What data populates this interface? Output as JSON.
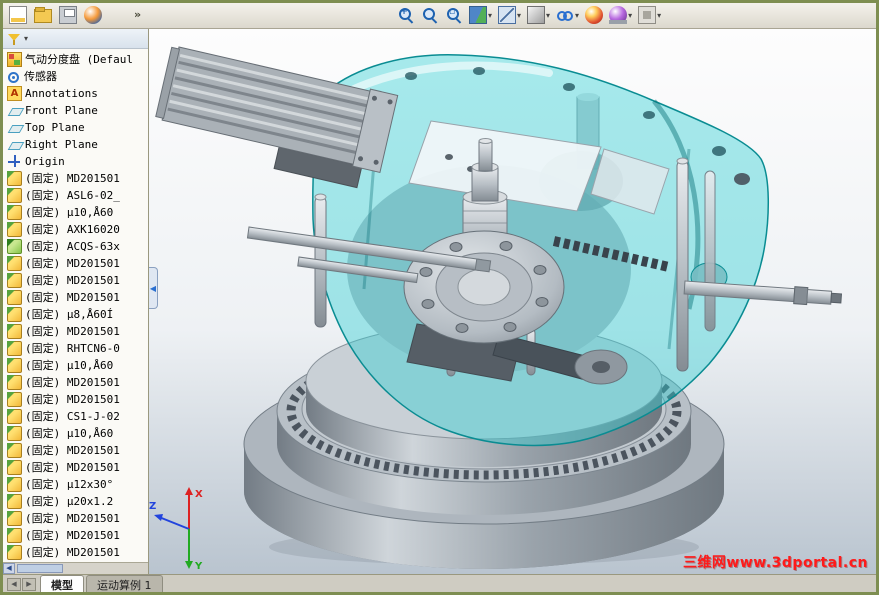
{
  "window": {
    "app": "SolidWorks"
  },
  "toolbar": {
    "overflow_label": "»",
    "left_icons": [
      {
        "name": "sheet-icon"
      },
      {
        "name": "open-folder-icon"
      },
      {
        "name": "print-icon"
      },
      {
        "name": "edrawings-icon"
      }
    ],
    "right_icons": [
      {
        "name": "zoom-in-icon",
        "mag": true,
        "glyph": "+",
        "dropdown": false
      },
      {
        "name": "zoom-fit-icon",
        "mag": true,
        "glyph": "",
        "dropdown": false
      },
      {
        "name": "zoom-area-icon",
        "mag": true,
        "glyph": "▫",
        "dropdown": false
      },
      {
        "name": "section-view-icon",
        "mag": false,
        "glyph": "",
        "dropdown": true
      },
      {
        "name": "view-orientation-icon",
        "mag": false,
        "glyph": "",
        "dropdown": true
      },
      {
        "name": "display-style-icon",
        "mag": false,
        "glyph": "",
        "dropdown": true
      },
      {
        "name": "hide-show-items-icon",
        "mag": false,
        "glyph": "",
        "dropdown": true
      },
      {
        "name": "edit-appearance-icon",
        "mag": false,
        "glyph": "",
        "dropdown": false
      },
      {
        "name": "apply-scene-icon",
        "mag": false,
        "glyph": "",
        "dropdown": true
      },
      {
        "name": "view-settings-icon",
        "mag": false,
        "glyph": "",
        "dropdown": true
      }
    ]
  },
  "feature_tree": {
    "root": {
      "label": "气动分度盘 (Defaul",
      "icon": "assembly"
    },
    "items": [
      {
        "label": "传感器",
        "icon": "sensors"
      },
      {
        "label": "Annotations",
        "icon": "annotations"
      },
      {
        "label": "Front Plane",
        "icon": "plane"
      },
      {
        "label": "Top Plane",
        "icon": "plane"
      },
      {
        "label": "Right Plane",
        "icon": "plane"
      },
      {
        "label": "Origin",
        "icon": "origin"
      },
      {
        "label": "(固定) MD201501",
        "icon": "part"
      },
      {
        "label": "(固定) ASL6-02_",
        "icon": "part"
      },
      {
        "label": "(固定) μ10,Å60",
        "icon": "part"
      },
      {
        "label": "(固定) AXK16020",
        "icon": "part"
      },
      {
        "label": "(固定) ACQS-63x",
        "icon": "part-green"
      },
      {
        "label": "(固定) MD201501",
        "icon": "part"
      },
      {
        "label": "(固定) MD201501",
        "icon": "part"
      },
      {
        "label": "(固定) MD201501",
        "icon": "part"
      },
      {
        "label": "(固定) μ8,Å60Í",
        "icon": "part"
      },
      {
        "label": "(固定) MD201501",
        "icon": "part"
      },
      {
        "label": "(固定) RHTCN6-0",
        "icon": "part"
      },
      {
        "label": "(固定) μ10,Å60",
        "icon": "part"
      },
      {
        "label": "(固定) MD201501",
        "icon": "part"
      },
      {
        "label": "(固定) MD201501",
        "icon": "part"
      },
      {
        "label": "(固定) CS1-J-02",
        "icon": "part"
      },
      {
        "label": "(固定) μ10,Å60",
        "icon": "part"
      },
      {
        "label": "(固定) MD201501",
        "icon": "part"
      },
      {
        "label": "(固定) MD201501",
        "icon": "part"
      },
      {
        "label": "(固定) μ12x30°",
        "icon": "part"
      },
      {
        "label": "(固定) μ20x1.2",
        "icon": "part"
      },
      {
        "label": "(固定) MD201501",
        "icon": "part"
      },
      {
        "label": "(固定) MD201501",
        "icon": "part"
      },
      {
        "label": "(固定) MD201501",
        "icon": "part"
      }
    ]
  },
  "viewport": {
    "watermark": "三维网www.3dportal.cn",
    "watermark_color": "#ff1a1a",
    "triad": {
      "x": "X",
      "y": "Y",
      "z": "Z"
    },
    "model_colors": {
      "housing_teal": "#2fd0d4",
      "metal": "#b5bdc5",
      "base": "#aeb6be"
    }
  },
  "tabs": {
    "active_index": 0,
    "items": [
      {
        "label": "模型"
      },
      {
        "label": "运动算例 1"
      }
    ]
  }
}
